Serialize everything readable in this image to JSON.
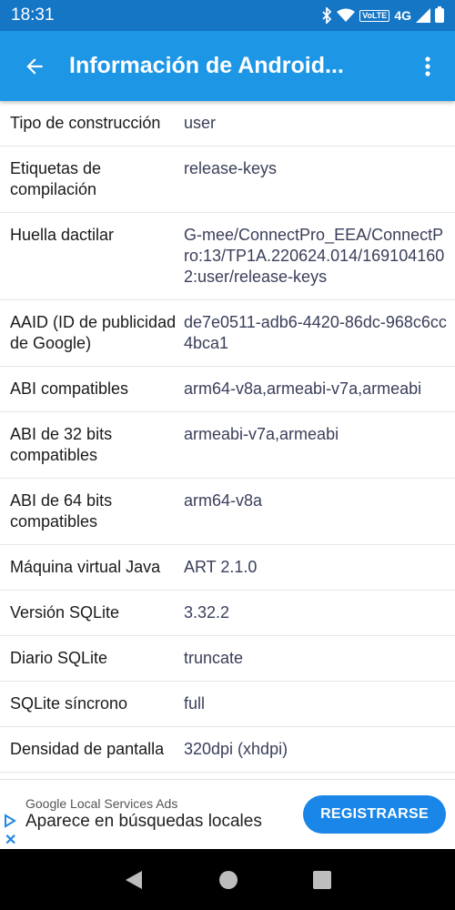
{
  "status_bar": {
    "time": "18:31",
    "volte": "VoLTE",
    "network": "4G"
  },
  "app_bar": {
    "title": "Información de Android..."
  },
  "rows": [
    {
      "label": "Tipo de construcción",
      "value": "user"
    },
    {
      "label": "Etiquetas de compilación",
      "value": "release-keys"
    },
    {
      "label": "Huella dactilar",
      "value": "G-mee/ConnectPro_EEA/ConnectPro:13/TP1A.220624.014/1691041602:user/release-keys"
    },
    {
      "label": "AAID (ID de publicidad de Google)",
      "value": "de7e0511-adb6-4420-86dc-968c6cc4bca1"
    },
    {
      "label": "ABI compatibles",
      "value": "arm64-v8a,armeabi-v7a,armeabi"
    },
    {
      "label": "ABI de 32 bits compatibles",
      "value": "armeabi-v7a,armeabi"
    },
    {
      "label": "ABI de 64 bits compatibles",
      "value": "arm64-v8a"
    },
    {
      "label": "Máquina virtual Java",
      "value": "ART 2.1.0"
    },
    {
      "label": "Versión SQLite",
      "value": "3.32.2"
    },
    {
      "label": "Diario SQLite",
      "value": "truncate"
    },
    {
      "label": "SQLite síncrono",
      "value": "full"
    },
    {
      "label": "Densidad de pantalla",
      "value": "320dpi (xhdpi)"
    }
  ],
  "ad": {
    "advertiser": "Google Local Services Ads",
    "headline": "Aparece en búsquedas locales",
    "cta": "REGISTRARSE"
  }
}
